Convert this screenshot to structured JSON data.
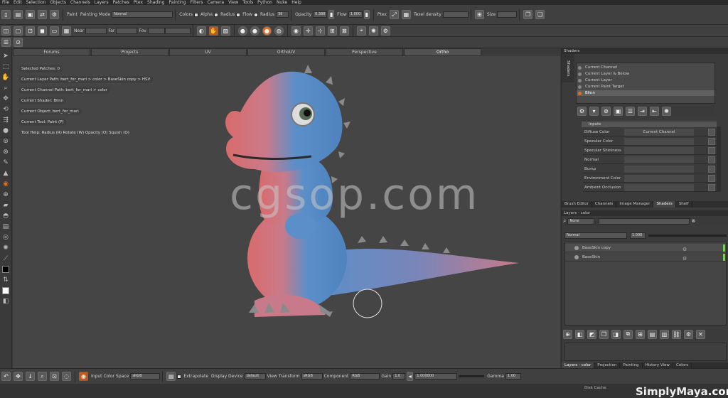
{
  "menu": [
    "File",
    "Edit",
    "Selection",
    "Objects",
    "Channels",
    "Layers",
    "Patches",
    "Ptex",
    "Shading",
    "Painting",
    "Filters",
    "Camera",
    "View",
    "Tools",
    "Python",
    "Nuke",
    "Help"
  ],
  "toolbar1": {
    "paint_label": "Paint",
    "painting_mode_label": "Painting Mode",
    "painting_mode_value": "Normal",
    "colors_label": "Colors",
    "alpha_label": "Alpha",
    "radius_check_label": "Radius",
    "flow_check_label": "Flow",
    "radius_label": "Radius",
    "radius_value": "36",
    "opacity_label": "Opacity",
    "opacity_value": "0.388",
    "flow_label": "Flow",
    "flow_value": "1.000",
    "ptex_label": "Ptex",
    "texel_density_label": "Texel density",
    "size_label": "Size"
  },
  "toolbar2": {
    "near_label": "Near",
    "far_label": "Far",
    "fov_label": "Fov"
  },
  "viewport_tabs": [
    "Forums",
    "Projects",
    "UV",
    "OrthoUV",
    "Perspective",
    "Ortho"
  ],
  "viewport_active_tab": "Ortho",
  "hud": {
    "selected_patches": "Selected Patches: 0",
    "current_layer_path": "Current Layer Path: bert_for_mari > color > BaseSkin copy > HSV",
    "current_channel_path": "Current Channel Path: bert_for_mari > color",
    "current_shader": "Current Shader: Blinn",
    "current_object": "Current Object: bert_for_mari",
    "current_tool": "Current Tool: Paint (P)",
    "tool_help": "Tool Help:    Radius (R)   Rotate (W)   Opacity (O)   Squish (Q)"
  },
  "watermark": "cgsop.com",
  "shaders": {
    "title": "Shaders",
    "side_tab": "Shaders",
    "list": [
      "Current Channel",
      "Current Layer & Below",
      "Current Layer",
      "Current Paint Target",
      "Blinn"
    ],
    "selected": "Blinn",
    "inputs_header": "Inputs",
    "inputs": [
      {
        "name": "Diffuse Color",
        "value": "Current Channel"
      },
      {
        "name": "Specular Color",
        "value": ""
      },
      {
        "name": "Specular Shininess",
        "value": ""
      },
      {
        "name": "Normal",
        "value": ""
      },
      {
        "name": "Bump",
        "value": ""
      },
      {
        "name": "Environment Color",
        "value": ""
      },
      {
        "name": "Ambient Occlusion",
        "value": ""
      }
    ]
  },
  "palette_tabs": [
    "Brush Editor",
    "Channels",
    "Image Manager",
    "Shaders",
    "Shelf"
  ],
  "palette_active": "Shaders",
  "layers": {
    "title": "Layers - color",
    "filter_value": "None",
    "blend_mode": "Normal",
    "opacity_value": "1.000",
    "items": [
      "BaseSkin copy",
      "BaseSkin"
    ]
  },
  "bottom_palette_tabs": [
    "Layers - color",
    "Projection",
    "Painting",
    "History View",
    "Colors"
  ],
  "bottom_palette_active": "Layers - color",
  "bottom_toolbar": {
    "input_color_space_label": "Input Color Space",
    "input_color_space_value": "sRGB",
    "extrapolate_label": "Extrapolate",
    "display_device_label": "Display Device",
    "display_device_value": "default",
    "view_transform_label": "View Transform",
    "view_transform_value": "sRGB",
    "component_label": "Component",
    "component_value": "RGB",
    "gain_label": "Gain",
    "gain_value": "1.0",
    "gain_field_value": "1.000000",
    "gamma_label": "Gamma",
    "gamma_value": "1.00"
  },
  "status": {
    "disk_cache": "Disk Cache",
    "brand_main": "SimplyMaya",
    "brand_suffix": ".com"
  },
  "colors": {
    "accent": "#e07020",
    "foreground_swatch": "#000000",
    "background_swatch": "#ffffff",
    "skin_blue": "#5b8fc9",
    "skin_red": "#d96b6b",
    "layer_green": "#6fd34a"
  }
}
